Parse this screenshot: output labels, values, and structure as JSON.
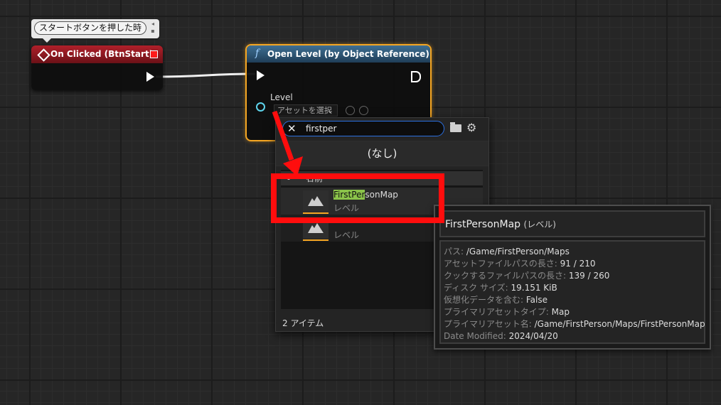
{
  "comment": {
    "text": "スタートボタンを押した時"
  },
  "event_node": {
    "title": "On Clicked (BtnStart)"
  },
  "function_node": {
    "title": "Open Level (by Object Reference)",
    "pin_label": "Level",
    "asset_select": "アセットを選択"
  },
  "picker": {
    "search_value": "firstper",
    "none_label": "(なし)",
    "column_name": "名前",
    "items": [
      {
        "name_match": "FirstPer",
        "name_rest": "sonMap",
        "type": "レベル"
      },
      {
        "name_match": "",
        "name_rest": "",
        "type": "レベル"
      }
    ],
    "count": "2 アイテム"
  },
  "tooltip": {
    "title": "FirstPersonMap",
    "title_type": "(レベル)",
    "rows": [
      {
        "key": "パス:",
        "value": "/Game/FirstPerson/Maps"
      },
      {
        "key": "アセットファイルパスの長さ:",
        "value": "91 / 210"
      },
      {
        "key": "クックするファイルパスの長さ:",
        "value": "139 / 260"
      },
      {
        "key": "ディスク サイズ:",
        "value": "19.151 KiB"
      },
      {
        "key": "仮想化データを含む:",
        "value": "False"
      },
      {
        "key": "プライマリアセットタイプ:",
        "value": "Map"
      },
      {
        "key": "プライマリアセット名:",
        "value": "/Game/FirstPerson/Maps/FirstPersonMap"
      },
      {
        "key": "Date Modified:",
        "value": "2024/04/20"
      }
    ]
  },
  "colors": {
    "event_header": "#b0202a",
    "function_header": "#3f6f93",
    "selection": "#f5a623",
    "highlight_annotation": "#ff0d0d",
    "search_match": "#8bc34a"
  },
  "icons": {
    "event": "diamond-icon",
    "function": "function-f-icon",
    "clear": "close-icon",
    "browse": "folder-icon",
    "settings": "gear-icon",
    "asset": "level-thumbnail-icon"
  }
}
